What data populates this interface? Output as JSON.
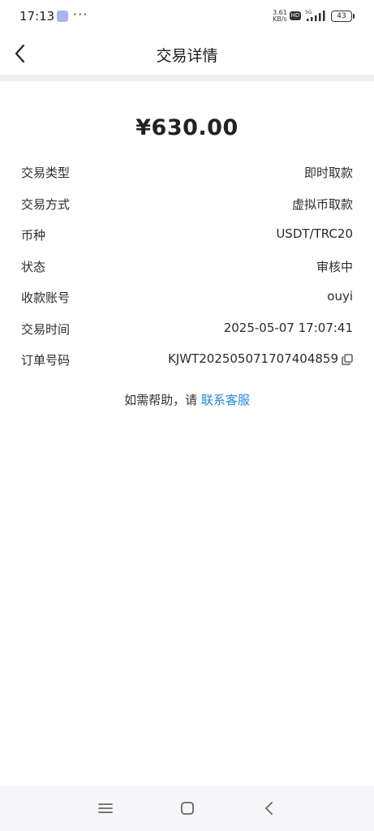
{
  "status_bar": {
    "time": "17:13",
    "dots": "···",
    "speed_top": "3.61",
    "speed_bottom": "KB/s",
    "hd": "HD",
    "network": "5G",
    "battery": "43"
  },
  "header": {
    "title": "交易详情",
    "back_icon": "chevron-left-icon"
  },
  "amount": "¥630.00",
  "details": [
    {
      "label": "交易类型",
      "value": "即时取款"
    },
    {
      "label": "交易方式",
      "value": "虚拟币取款"
    },
    {
      "label": "币种",
      "value": "USDT/TRC20"
    },
    {
      "label": "状态",
      "value": "审核中"
    },
    {
      "label": "收款账号",
      "value": "ouyi"
    },
    {
      "label": "交易时间",
      "value": "2025-05-07 17:07:41"
    },
    {
      "label": "订单号码",
      "value": "KJWT202505071707404859"
    }
  ],
  "help": {
    "text": "如需帮助，请",
    "link": "联系客服"
  },
  "colors": {
    "accent": "#1e88e5",
    "divider": "#eef0f3",
    "nav_bg": "#f7f7f9"
  },
  "nav": {
    "menu_icon": "menu-icon",
    "home_icon": "home-square-icon",
    "back_icon": "back-triangle-icon"
  }
}
